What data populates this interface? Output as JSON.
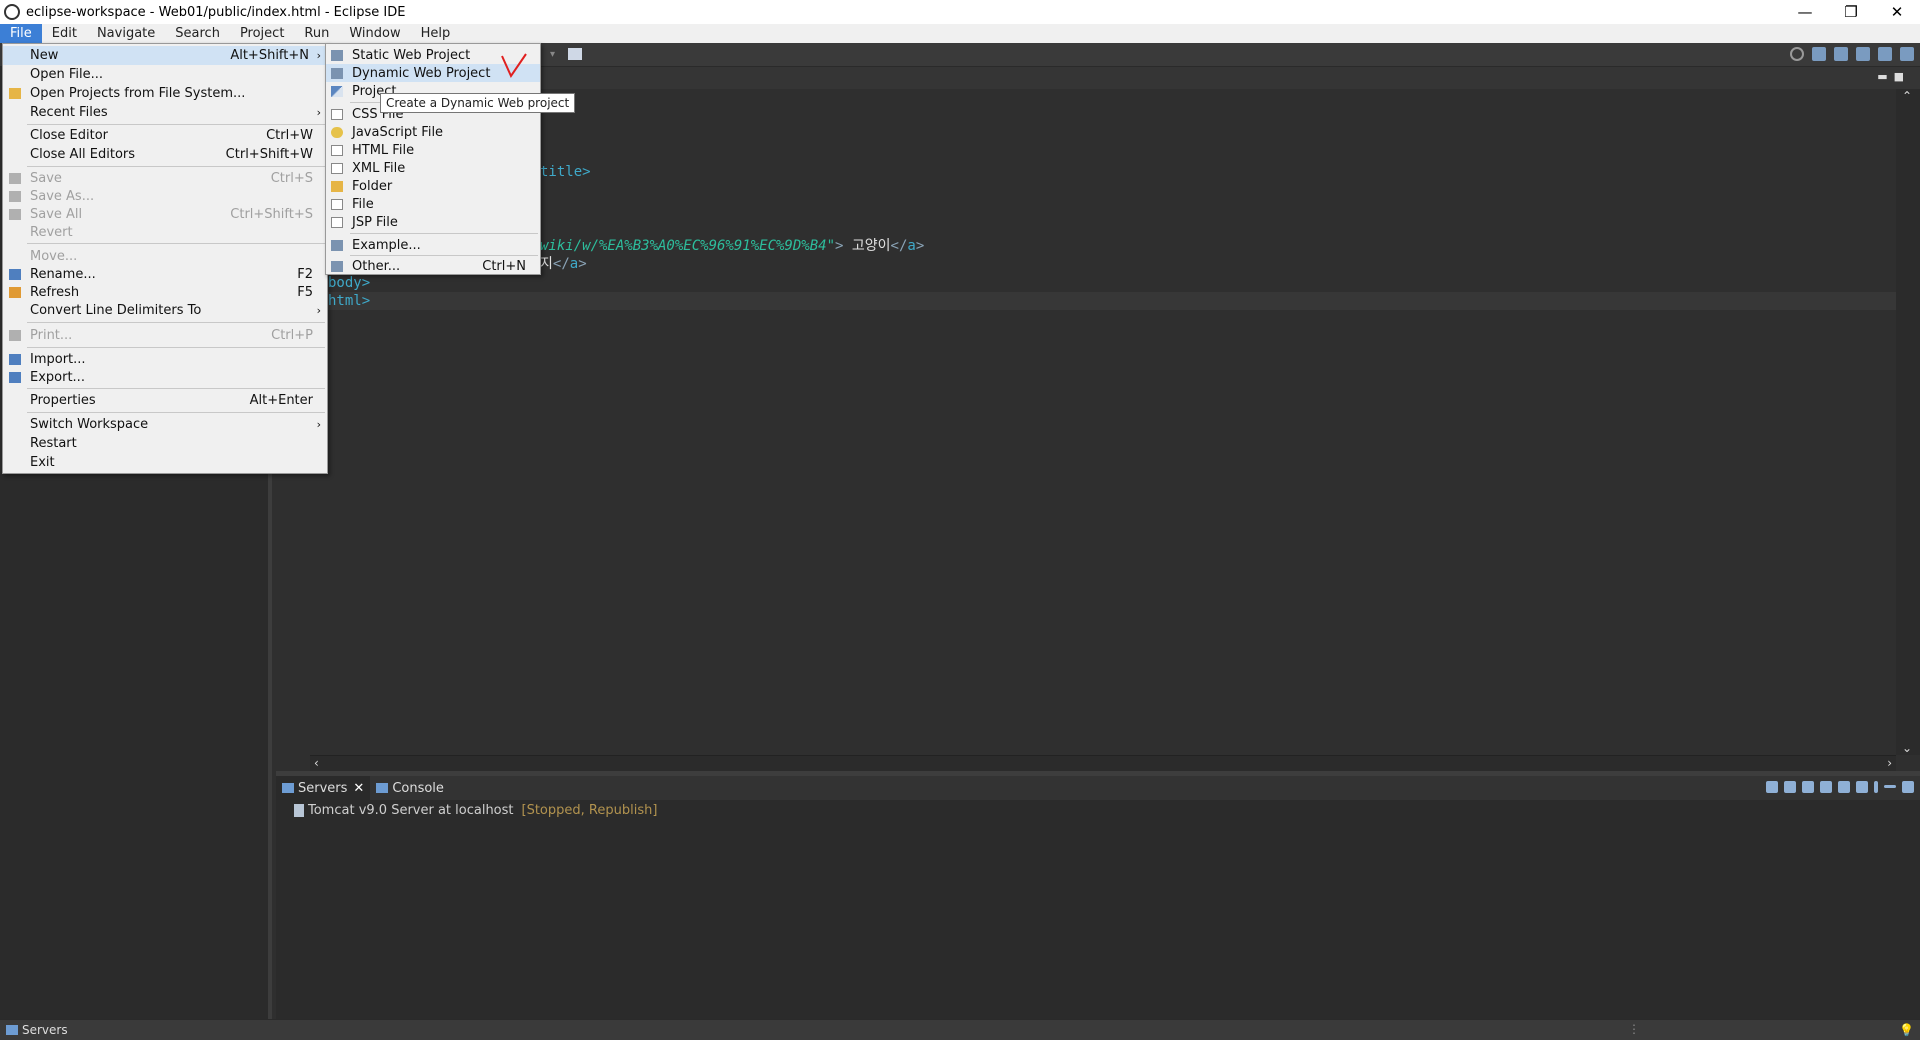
{
  "window": {
    "title": "eclipse-workspace - Web01/public/index.html - Eclipse IDE",
    "minimize": "—",
    "restore": "❐",
    "close": "✕"
  },
  "menubar": [
    "File",
    "Edit",
    "Navigate",
    "Search",
    "Project",
    "Run",
    "Window",
    "Help"
  ],
  "file_menu": {
    "items": [
      {
        "label": "New",
        "shortcut": "Alt+Shift+N",
        "submenu": true,
        "highlighted": true
      },
      {
        "label": "Open File...",
        "shortcut": ""
      },
      {
        "label": "Open Projects from File System...",
        "shortcut": "",
        "icon": "folder-icon"
      },
      {
        "label": "Recent Files",
        "shortcut": "",
        "submenu": true
      },
      {
        "label": "Close Editor",
        "shortcut": "Ctrl+W"
      },
      {
        "label": "Close All Editors",
        "shortcut": "Ctrl+Shift+W"
      },
      {
        "label": "Save",
        "shortcut": "Ctrl+S",
        "disabled": true
      },
      {
        "label": "Save As...",
        "shortcut": "",
        "disabled": true
      },
      {
        "label": "Save All",
        "shortcut": "Ctrl+Shift+S",
        "disabled": true
      },
      {
        "label": "Revert",
        "shortcut": "",
        "disabled": true
      },
      {
        "label": "Move...",
        "shortcut": "",
        "disabled": true
      },
      {
        "label": "Rename...",
        "shortcut": "F2"
      },
      {
        "label": "Refresh",
        "shortcut": "F5"
      },
      {
        "label": "Convert Line Delimiters To",
        "shortcut": "",
        "submenu": true
      },
      {
        "label": "Print...",
        "shortcut": "Ctrl+P",
        "disabled": true
      },
      {
        "label": "Import...",
        "shortcut": ""
      },
      {
        "label": "Export...",
        "shortcut": ""
      },
      {
        "label": "Properties",
        "shortcut": "Alt+Enter"
      },
      {
        "label": "Switch Workspace",
        "shortcut": "",
        "submenu": true
      },
      {
        "label": "Restart",
        "shortcut": ""
      },
      {
        "label": "Exit",
        "shortcut": ""
      }
    ]
  },
  "new_submenu": {
    "items": [
      {
        "label": "Static Web Project",
        "shortcut": ""
      },
      {
        "label": "Dynamic Web Project",
        "shortcut": "",
        "highlighted": true
      },
      {
        "label": "Project...",
        "shortcut": ""
      },
      {
        "label": "CSS File",
        "shortcut": ""
      },
      {
        "label": "JavaScript File",
        "shortcut": ""
      },
      {
        "label": "HTML File",
        "shortcut": ""
      },
      {
        "label": "XML File",
        "shortcut": ""
      },
      {
        "label": "Folder",
        "shortcut": ""
      },
      {
        "label": "File",
        "shortcut": ""
      },
      {
        "label": "JSP File",
        "shortcut": ""
      },
      {
        "label": "Example...",
        "shortcut": ""
      },
      {
        "label": "Other...",
        "shortcut": "Ctrl+N"
      }
    ]
  },
  "tooltip": "Create a Dynamic Web project",
  "editor": {
    "line_title": "title>",
    "line_link1_href": "wiki/w/%EA%B3%A0%EC%96%91%EC%9D%B4\"",
    "line_link1_text": "고양이",
    "line_link2_text": "지",
    "line_body": "body>",
    "line_html": "html>"
  },
  "bottom_panel": {
    "tabs": [
      {
        "label": "Servers",
        "active": true
      },
      {
        "label": "Console",
        "active": false
      }
    ],
    "server_name": "Tomcat v9.0 Server at localhost",
    "server_state": "[Stopped, Republish]"
  },
  "statusbar": {
    "label": "Servers"
  },
  "colors": {
    "menu_active": "#3c7fd6",
    "menu_highlight": "#d0e2f4",
    "tag": "#3fa9c9",
    "string": "#2dbd9c"
  }
}
